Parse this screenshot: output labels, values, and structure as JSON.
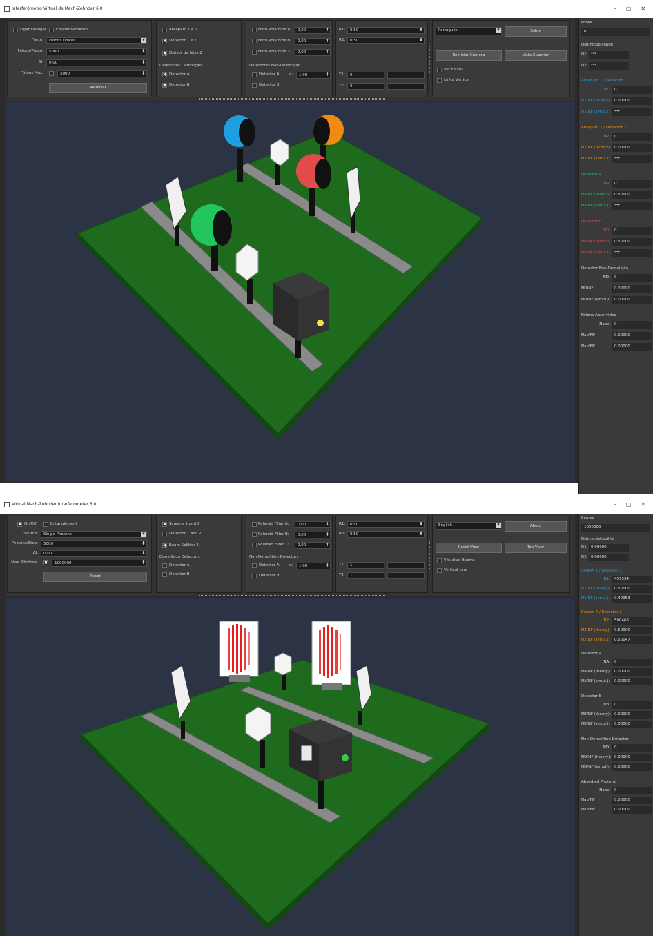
{
  "colors": {
    "screen1": "#1f9fe0",
    "screen2": "#f08a10",
    "detectorA": "#22c55e",
    "detectorB": "#e24b4b",
    "board": "#1e6b1e",
    "viewport_bg": "#2b3344"
  },
  "pt": {
    "title": "Interferômetro Virtual de Mach-Zehnder 6.0",
    "panel1": {
      "onoff": "Ligar/Desligar",
      "entangle": "Emaranhamento",
      "source_label": "Fonte:",
      "source_value": "Fótons Únicos",
      "photons_step_label": "Fótons/Passo:",
      "photons_step_value": "5000",
      "dl_label": "Δl:",
      "dl_value": "0,00",
      "max_label": "Fótons Máx.",
      "max_value": "5000",
      "reset": "Reiniciar"
    },
    "panel2": {
      "c1": "Anteparo 1 e 2",
      "c2": "Detector 1 e 2",
      "c3": "Divisor de feixe 2",
      "sect": "Detectores Demolição",
      "c4": "Detector A",
      "c5": "Detector B"
    },
    "panel3": {
      "f1": "Filtro Polaróide A:",
      "f2": "Filtro Polaróide B:",
      "f3": "Filtro Polaróide 1:",
      "v1": "0,00",
      "v2": "0,00",
      "v3": "0,00",
      "sect": "Detectores Não-Demolição",
      "c1": "Detector A",
      "alpha_label": "α:",
      "alpha_value": "1,00",
      "c2": "Detector B"
    },
    "panel4": {
      "r1_label": "R1:",
      "r1_value": "0,50",
      "r2_label": "R2:",
      "r2_value": "0,50",
      "y1_label": "Y1:",
      "y1_value": "0",
      "y2_label": "Y2:",
      "y2_value": "0"
    },
    "panel5": {
      "lang": "Português",
      "about": "Sobre",
      "reset_cam": "Reiniciar Câmera",
      "top_view": "Vista Superior",
      "c1": "Ver Feixes",
      "c2": "Linha Vertical"
    },
    "side": {
      "source_head": "Fonte",
      "source_value": "0",
      "dist_head": "Distinguibilidade",
      "d1_label": "D1:",
      "d1_value": "***",
      "d2_label": "D2:",
      "d2_value": "***",
      "s1_head": "Anteparo 1 / Detector 1",
      "s1_n_label": "N1:",
      "s1_n": "0",
      "s1_t_label": "N1/NF (teórico):",
      "s1_t": "0.00000",
      "s1_s_label": "N1/NF (simul.):",
      "s1_s": "***",
      "s2_head": "Anteparo 2 / Detector 2",
      "s2_n_label": "N2:",
      "s2_n": "0",
      "s2_t_label": "N2/NF (teórico):",
      "s2_t": "0.00000",
      "s2_s_label": "N2/NF (simul.):",
      "s2_s": "***",
      "a_head": "Detector A",
      "a_n_label": "NA:",
      "a_n": "0",
      "a_t_label": "NA/NF (teórico):",
      "a_t": "0.50000",
      "a_s_label": "NA/NF (simul.):",
      "a_s": "***",
      "b_head": "Detector B",
      "b_n_label": "NB:",
      "b_n": "0",
      "b_t_label": "NB/NF (teórico):",
      "b_t": "0.50000",
      "b_s_label": "NB/NF (simul.):",
      "b_s": "***",
      "nd_head": "Detector Não-Demolição",
      "nd_n_label": "ND:",
      "nd_n": "0",
      "nd_t_label": "ND/NF (teórico):",
      "nd_t": "0.00000",
      "nd_s_label": "ND/NF (simul.):",
      "nd_s": "0.00000",
      "ab_head": "Fótons Absorvidos",
      "ab_n_label": "Nabs:",
      "ab_n": "0",
      "ab_t_label": "Nab/NF (teórico):",
      "ab_t": "0.00000",
      "ab_s_label": "Nab/NF (simul.):",
      "ab_s": "0.00000"
    }
  },
  "en": {
    "title": "Virtual Mach-Zehnder Interferometer 6.0",
    "panel1": {
      "onoff": "On/Off",
      "entangle": "Entanglement",
      "source_label": "Source:",
      "source_value": "Single Photons",
      "photons_step_label": "Photons/Step:",
      "photons_step_value": "5000",
      "dl_label": "Δl:",
      "dl_value": "0,00",
      "max_label": "Max. Photons:",
      "max_value": "1000000",
      "reset": "Reset"
    },
    "panel2": {
      "c1": "Screens 1 and 2",
      "c2": "Detector 1 and 2",
      "c3": "Beam Splitter 2",
      "sect": "Demolition Detectors",
      "c4": "Detector A",
      "c5": "Detector B"
    },
    "panel3": {
      "f1": "Polaroid Filter A:",
      "f2": "Polaroid Filter B:",
      "f3": "Polaroid Filter 1:",
      "v1": "0,00",
      "v2": "0,00",
      "v3": "0,00",
      "sect": "Non-Demolition Detectors",
      "c1": "Detector A",
      "alpha_label": "α:",
      "alpha_value": "1,00",
      "c2": "Detector B"
    },
    "panel4": {
      "r1_label": "R1:",
      "r1_value": "0,50",
      "r2_label": "R2:",
      "r2_value": "0,50",
      "y1_label": "Y1:",
      "y1_value": "1",
      "y2_label": "Y2:",
      "y2_value": "1"
    },
    "panel5": {
      "lang": "English",
      "about": "About",
      "reset_cam": "Reset View",
      "top_view": "Top View",
      "c1": "Visualize Beams",
      "c2": "Vertical Line"
    },
    "side": {
      "source_head": "Source",
      "source_value": "1000000",
      "dist_head": "Distinguishability",
      "d1_label": "D1:",
      "d1_value": "0.00000",
      "d2_label": "D2:",
      "d2_value": "0.00000",
      "s1_head": "Screen 1 / Detector 1",
      "s1_n_label": "N1:",
      "s1_n": "499534",
      "s1_t_label": "N1/NF (theory):",
      "s1_t": "0.50000",
      "s1_s_label": "N1/NF (simul.):",
      "s1_s": "0.49953",
      "s2_head": "Screen 2 / Detector 2",
      "s2_n_label": "N2:",
      "s2_n": "500466",
      "s2_t_label": "N2/NF (theory):",
      "s2_t": "0.50000",
      "s2_s_label": "N2/NF (simul.):",
      "s2_s": "0.50047",
      "a_head": "Detector A",
      "a_n_label": "NA:",
      "a_n": "0",
      "a_t_label": "NA/NF (theory):",
      "a_t": "0.00000",
      "a_s_label": "NA/NF (simul.):",
      "a_s": "0.00000",
      "b_head": "Detector B",
      "b_n_label": "NB:",
      "b_n": "0",
      "b_t_label": "NB/NF (theory):",
      "b_t": "0.00000",
      "b_s_label": "NB/NF (simul.):",
      "b_s": "0.00000",
      "nd_head": "Non-Demolition Detector",
      "nd_n_label": "ND:",
      "nd_n": "0",
      "nd_t_label": "ND/NF (theory):",
      "nd_t": "0.00000",
      "nd_s_label": "ND/NF (simul.):",
      "nd_s": "0.00000",
      "ab_head": "Absorbed Photons",
      "ab_n_label": "Nabs:",
      "ab_n": "0",
      "ab_t_label": "Nab/NF (theory):",
      "ab_t": "0.00000",
      "ab_s_label": "Nab/NF (simul.):",
      "ab_s": "0.00000"
    }
  }
}
